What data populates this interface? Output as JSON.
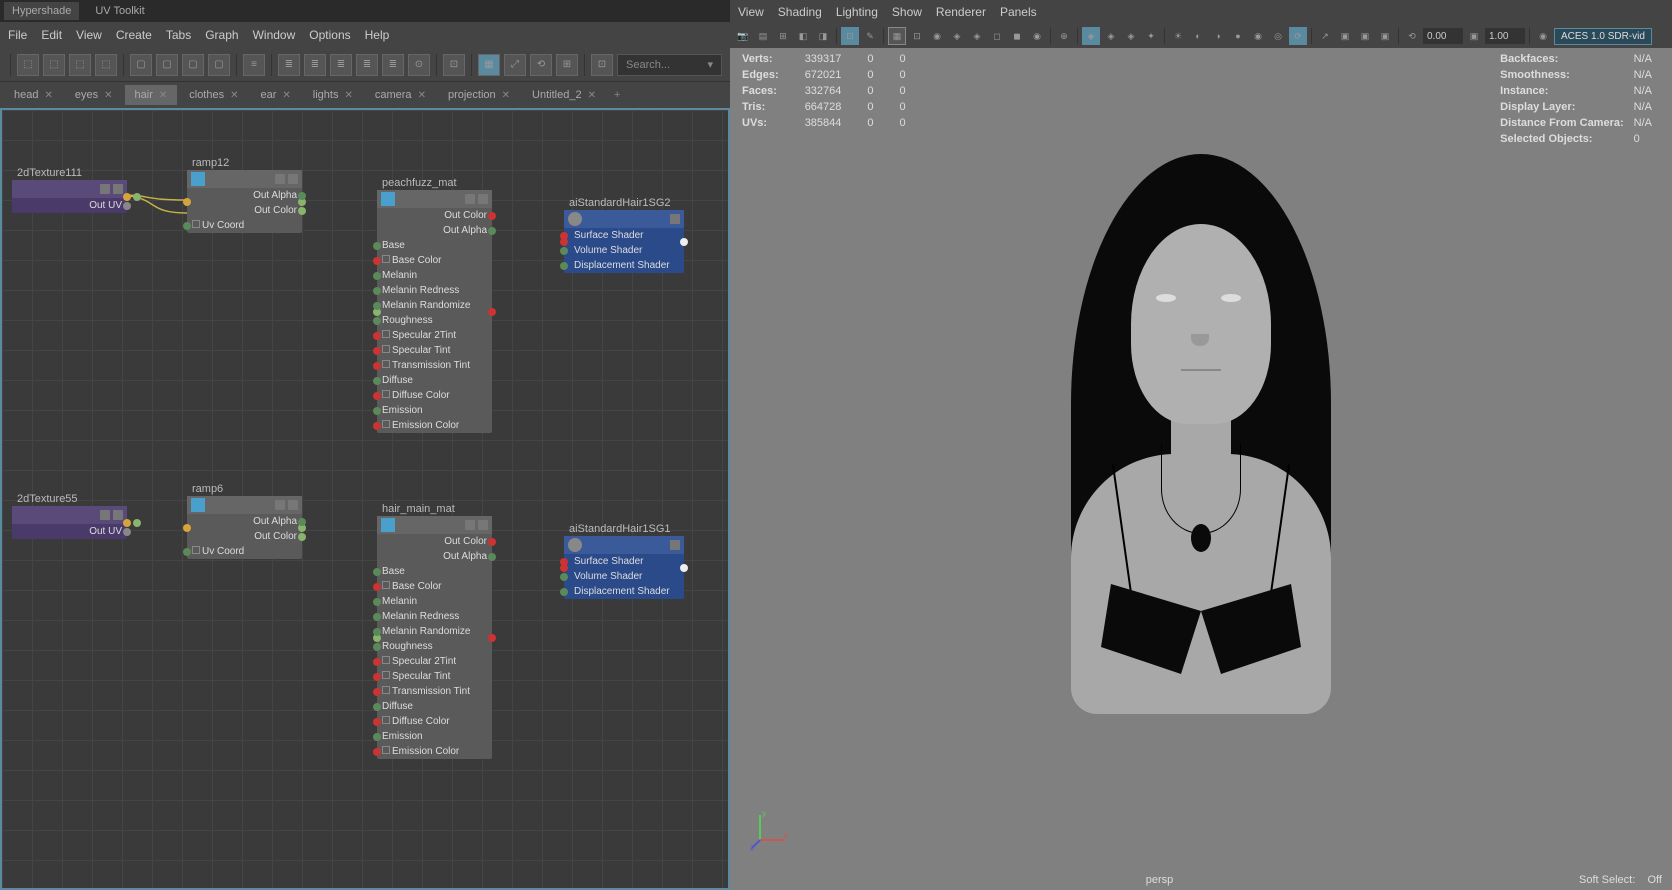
{
  "topTabs": [
    "Hypershade",
    "UV Toolkit"
  ],
  "menu": [
    "File",
    "Edit",
    "View",
    "Create",
    "Tabs",
    "Graph",
    "Window",
    "Options",
    "Help"
  ],
  "searchPlaceholder": "Search...",
  "graphTabs": [
    {
      "label": "head"
    },
    {
      "label": "eyes"
    },
    {
      "label": "hair",
      "sel": true
    },
    {
      "label": "clothes"
    },
    {
      "label": "ear"
    },
    {
      "label": "lights"
    },
    {
      "label": "camera"
    },
    {
      "label": "projection"
    },
    {
      "label": "Untitled_2"
    }
  ],
  "nodes": {
    "tex1": {
      "title": "2dTexture111",
      "rows": [
        "Out UV"
      ]
    },
    "tex2": {
      "title": "2dTexture55",
      "rows": [
        "Out UV"
      ]
    },
    "ramp1": {
      "title": "ramp12",
      "outs": [
        "Out Alpha",
        "Out Color"
      ],
      "ins": [
        "Uv Coord"
      ]
    },
    "ramp2": {
      "title": "ramp6",
      "outs": [
        "Out Alpha",
        "Out Color"
      ],
      "ins": [
        "Uv Coord"
      ]
    },
    "mat1": {
      "title": "peachfuzz_mat",
      "outs": [
        "Out Color",
        "Out Alpha"
      ],
      "attrs": [
        "Base",
        "Base Color",
        "Melanin",
        "Melanin Redness",
        "Melanin Randomize",
        "Roughness",
        "Specular 2Tint",
        "Specular Tint",
        "Transmission Tint",
        "Diffuse",
        "Diffuse Color",
        "Emission",
        "Emission Color"
      ]
    },
    "mat2": {
      "title": "hair_main_mat",
      "outs": [
        "Out Color",
        "Out Alpha"
      ],
      "attrs": [
        "Base",
        "Base Color",
        "Melanin",
        "Melanin Redness",
        "Melanin Randomize",
        "Roughness",
        "Specular 2Tint",
        "Specular Tint",
        "Transmission Tint",
        "Diffuse",
        "Diffuse Color",
        "Emission",
        "Emission Color"
      ]
    },
    "sg1": {
      "title": "aiStandardHair1SG2",
      "rows": [
        "Surface Shader",
        "Volume Shader",
        "Displacement Shader"
      ]
    },
    "sg2": {
      "title": "aiStandardHair1SG1",
      "rows": [
        "Surface Shader",
        "Volume Shader",
        "Displacement Shader"
      ]
    }
  },
  "vpMenu": [
    "View",
    "Shading",
    "Lighting",
    "Show",
    "Renderer",
    "Panels"
  ],
  "vpNums": {
    "a": "0.00",
    "b": "1.00"
  },
  "aces": "ACES 1.0 SDR-vid",
  "statsL": [
    {
      "k": "Verts:",
      "v1": "339317",
      "v2": "0",
      "v3": "0"
    },
    {
      "k": "Edges:",
      "v1": "672021",
      "v2": "0",
      "v3": "0"
    },
    {
      "k": "Faces:",
      "v1": "332764",
      "v2": "0",
      "v3": "0"
    },
    {
      "k": "Tris:",
      "v1": "664728",
      "v2": "0",
      "v3": "0"
    },
    {
      "k": "UVs:",
      "v1": "385844",
      "v2": "0",
      "v3": "0"
    }
  ],
  "statsR": [
    {
      "k": "Backfaces:",
      "v": "N/A"
    },
    {
      "k": "Smoothness:",
      "v": "N/A"
    },
    {
      "k": "Instance:",
      "v": "N/A"
    },
    {
      "k": "Display Layer:",
      "v": "N/A"
    },
    {
      "k": "Distance From Camera:",
      "v": "N/A"
    },
    {
      "k": "Selected Objects:",
      "v": "0"
    }
  ],
  "vpBottom": {
    "cam": "persp",
    "soft": "Soft Select:",
    "off": "Off"
  }
}
